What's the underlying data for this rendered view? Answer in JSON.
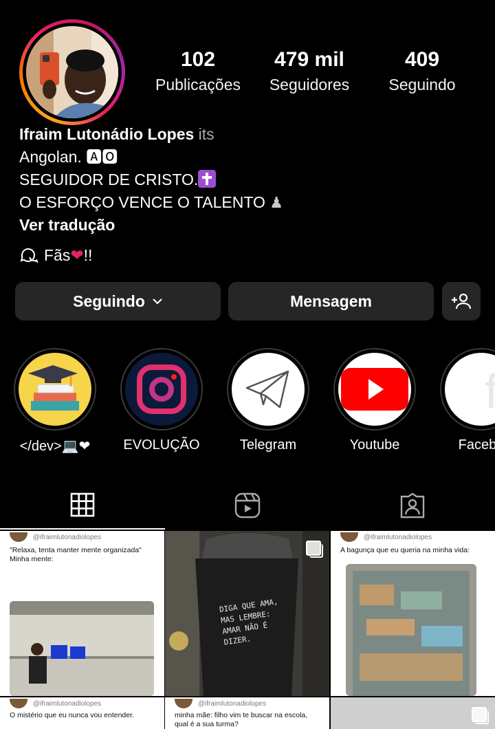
{
  "profile": {
    "name": "Ifraim Lutonádio Lopes",
    "bio_suffix": "its",
    "bio_line2": "Angolan. 🅰🅾",
    "bio_line3": "SEGUIDOR DE CRISTO.",
    "bio_line4": "O ESFORÇO VENCE O TALENTO",
    "translate": "Ver tradução",
    "channel_label": "Fãs",
    "channel_suffix": "!!"
  },
  "stats": {
    "posts_count": "102",
    "posts_label": "Publicações",
    "followers_count": "479 mil",
    "followers_label": "Seguidores",
    "following_count": "409",
    "following_label": "Seguindo"
  },
  "actions": {
    "following_label": "Seguindo",
    "message_label": "Mensagem"
  },
  "highlights": [
    {
      "label": "</dev>💻❤"
    },
    {
      "label": "EVOLUÇÃO"
    },
    {
      "label": "Telegram"
    },
    {
      "label": "Youtube"
    },
    {
      "label": "Facebo"
    }
  ],
  "posts": {
    "p1_user": "@ifraimlutonadiolopes",
    "p1_line1": "\"Relaxa, tenta manter mente organizada\"",
    "p1_line2": "Minha mente:",
    "p2_text": "DIGA QUE AMA, MAS LEMBRE: AMAR NÃO É DIZER.",
    "p3_user": "@ifraimlutonadiolopes",
    "p3_line1": "A bagunça que eu queria na minha vida:",
    "p4_user": "@ifraimlutonadiolopes",
    "p4_line1": "O mistério que eu nunca vou entender.",
    "p5_user": "@ifraimlutonadiolopes",
    "p5_line1": "minha mãe: filho vim te buscar na escola,",
    "p5_line2": "qual é a sua turma?"
  },
  "colors": {
    "background": "#000000",
    "button": "#262626",
    "heart": "#e0245e",
    "youtube": "#ff0000"
  }
}
